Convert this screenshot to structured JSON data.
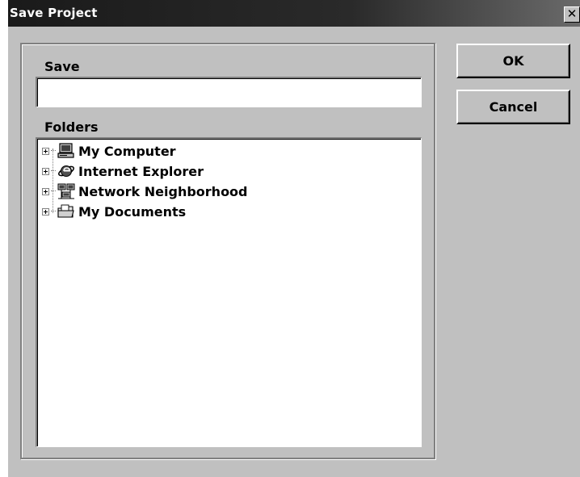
{
  "window": {
    "title": "Save Project",
    "close_label": "✕"
  },
  "form": {
    "save_label": "Save",
    "save_value": "",
    "folders_label": "Folders"
  },
  "folders": [
    {
      "label": "My Computer",
      "icon": "computer-icon"
    },
    {
      "label": "Internet Explorer",
      "icon": "internet-explorer-icon"
    },
    {
      "label": "Network Neighborhood",
      "icon": "network-icon"
    },
    {
      "label": "My Documents",
      "icon": "folder-icon"
    }
  ],
  "buttons": {
    "ok_label": "OK",
    "cancel_label": "Cancel"
  }
}
